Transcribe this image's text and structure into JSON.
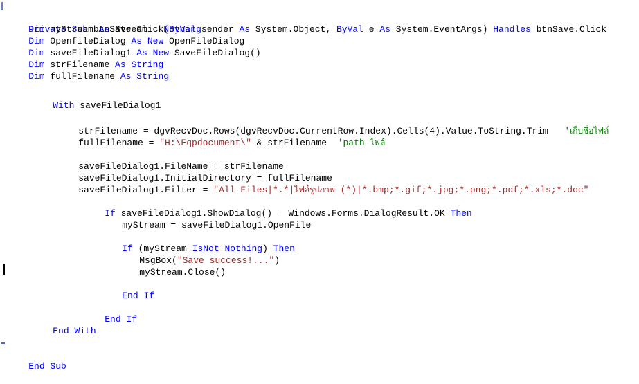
{
  "editor": {
    "language": "Visual Basic .NET",
    "background_color": "#ffffff",
    "keyword_color": "#0000ff",
    "string_color": "#a52a2a",
    "comment_color": "#008000",
    "text_color": "#000000",
    "caret_color": "#000000"
  },
  "code": {
    "line_01": {
      "kw1": "Private",
      "kw2": "Sub",
      "name": " btnSave_Click(",
      "kw3": "ByVal",
      "p1": " sender ",
      "kw4": "As",
      "p2": " System.Object, ",
      "kw5": "ByVal",
      "p3": " e ",
      "kw6": "As",
      "p4": " System.EventArgs) ",
      "kw7": "Handles",
      "p5": " btnSave.Click"
    },
    "line_02": {
      "kw1": "Dim",
      "p1": " myStream ",
      "kw2": "As",
      "p2": " Stream = ",
      "kw3": "Nothing"
    },
    "line_03": {
      "kw1": "Dim",
      "p1": " OpenfileDialog ",
      "kw2": "As",
      "p2": " ",
      "kw3": "New",
      "p3": " OpenFileDialog"
    },
    "line_04": {
      "kw1": "Dim",
      "p1": " saveFileDialog1 ",
      "kw2": "As",
      "p2": " ",
      "kw3": "New",
      "p3": " SaveFileDialog()"
    },
    "line_05": {
      "kw1": "Dim",
      "p1": " strFilename ",
      "kw2": "As",
      "p2": " ",
      "kw3": "String"
    },
    "line_06": {
      "kw1": "Dim",
      "p1": " fullFilename ",
      "kw2": "As",
      "p2": " ",
      "kw3": "String"
    },
    "line_08": {
      "kw1": "With",
      "p1": " saveFileDialog1"
    },
    "line_10": {
      "p1": "strFilename = dgvRecvDoc.Rows(dgvRecvDoc.CurrentRow.Index).Cells(4).Value.ToString.Trim",
      "com1": "'",
      "com1_th": "เก็บชื่อไฟล์"
    },
    "line_11": {
      "p1": "fullFilename = ",
      "str1": "\"H:\\Eqpdocument\\\"",
      "p2": " & strFilename  ",
      "com1": "'path ",
      "com1_th": "ไฟล์"
    },
    "line_13": {
      "p1": "saveFileDialog1.FileName = strFilename"
    },
    "line_14": {
      "p1": "saveFileDialog1.InitialDirectory = fullFilename"
    },
    "line_15": {
      "p1": "saveFileDialog1.Filter = ",
      "str1": "\"All Files|*.*|",
      "str1_th": "ไฟล์รูปภาพ",
      "str2": " (*)|*.bmp;*.gif;*.jpg;*.png;*.pdf;*.xls;*.doc\""
    },
    "line_17": {
      "kw1": "If",
      "p1": " saveFileDialog1.ShowDialog() = Windows.Forms.DialogResult.OK ",
      "kw2": "Then"
    },
    "line_18": {
      "p1": "myStream = saveFileDialog1.OpenFile"
    },
    "line_20": {
      "kw1": "If",
      "p1": " (myStream ",
      "kw2": "IsNot",
      "p2": " ",
      "kw3": "Nothing",
      "p3": ") ",
      "kw4": "Then"
    },
    "line_21": {
      "p1": "MsgBox(",
      "str1": "\"Save success!...\"",
      "p2": ")"
    },
    "line_22": {
      "p1": "myStream.Close()"
    },
    "line_24": {
      "kw1": "End",
      "p1": " ",
      "kw2": "If"
    },
    "line_26": {
      "kw1": "End",
      "p1": " ",
      "kw2": "If"
    },
    "line_27": {
      "kw1": "End",
      "p1": " ",
      "kw2": "With"
    },
    "line_29": {
      "kw1": "End",
      "p1": " ",
      "kw2": "Sub"
    }
  }
}
